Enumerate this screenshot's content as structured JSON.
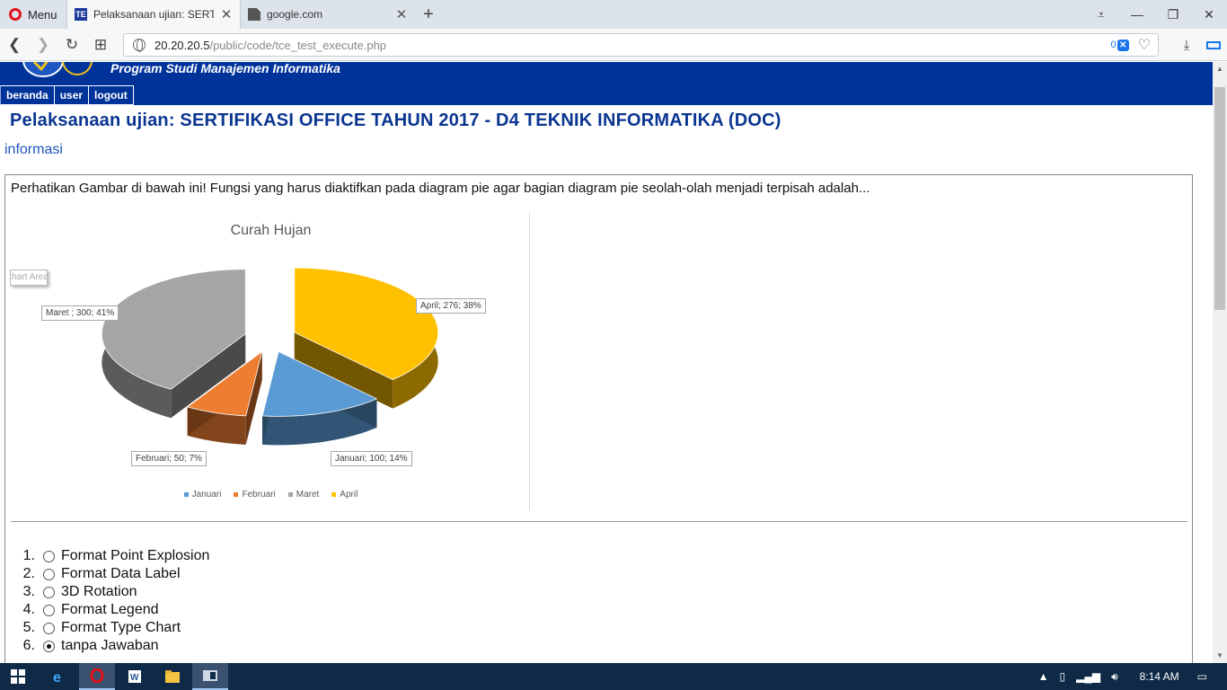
{
  "browser": {
    "menu_label": "Menu",
    "tabs": [
      {
        "title": "Pelaksanaan ujian: SERTIFI",
        "icon": "te-favicon",
        "active": true
      },
      {
        "title": "google.com",
        "icon": "document-icon",
        "active": false
      }
    ],
    "url_host": "20.20.20.5",
    "url_path": "/public/code/tce_test_execute.php",
    "adblock_count": "0"
  },
  "site": {
    "subtitle": "Program Studi Manajemen Informatika",
    "nav": [
      "beranda",
      "user",
      "logout"
    ],
    "page_title": "Pelaksanaan ujian: SERTIFIKASI OFFICE TAHUN 2017 - D4 TEKNIK INFORMATIKA (DOC)",
    "info_link": "informasi"
  },
  "question": {
    "text": "Perhatikan Gambar di bawah ini! Fungsi yang harus diaktifkan pada diagram pie agar bagian diagram pie seolah-olah menjadi terpisah adalah...",
    "options": [
      {
        "num": "1.",
        "label": "Format Point Explosion",
        "checked": false
      },
      {
        "num": "2.",
        "label": "Format Data Label",
        "checked": false
      },
      {
        "num": "3.",
        "label": "3D Rotation",
        "checked": false
      },
      {
        "num": "4.",
        "label": "Format Legend",
        "checked": false
      },
      {
        "num": "5.",
        "label": "Format Type Chart",
        "checked": false
      },
      {
        "num": "6.",
        "label": "tanpa Jawaban",
        "checked": true
      }
    ]
  },
  "chart_data": {
    "type": "pie",
    "title": "Curah Hujan",
    "tooltip": "Chart Area",
    "categories": [
      "Januari",
      "Februari",
      "Maret",
      "April"
    ],
    "values": [
      100,
      50,
      300,
      276
    ],
    "percents": [
      14,
      7,
      41,
      38
    ],
    "labels": [
      "Januari; 100; 14%",
      "Februari; 50; 7%",
      "Maret ; 300; 41%",
      "April; 276; 38%"
    ],
    "colors": [
      "#5b9bd5",
      "#ed7d31",
      "#a5a5a5",
      "#ffc000"
    ],
    "exploded": true,
    "style": "3d"
  },
  "taskbar": {
    "time": "8:14 AM",
    "apps": [
      "internet-explorer",
      "opera",
      "word",
      "file-explorer",
      "app-window"
    ]
  }
}
